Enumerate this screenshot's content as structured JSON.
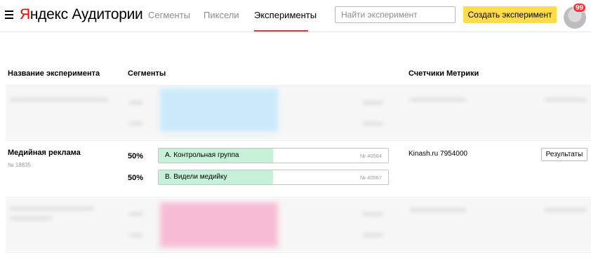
{
  "header": {
    "logo_brand": "Яндекс",
    "logo_product": "Аудитории",
    "nav": [
      {
        "label": "Сегменты",
        "active": false
      },
      {
        "label": "Пиксели",
        "active": false
      },
      {
        "label": "Эксперименты",
        "active": true
      }
    ],
    "search_placeholder": "Найти эксперимент",
    "create_button": "Создать эксперимент",
    "notifications_count": "99"
  },
  "table": {
    "columns": [
      "Название эксперимента",
      "Сегменты",
      "Счетчики Метрики"
    ],
    "experiment": {
      "name": "Медийная реклама",
      "id": "№ 18835",
      "segments": [
        {
          "percent": "50%",
          "label": "А. Контрольная группа",
          "number": "№ 40564"
        },
        {
          "percent": "50%",
          "label": "В. Видели медийку",
          "number": "№ 40567"
        }
      ],
      "counter": "Kinash.ru  7954000",
      "results_button": "Результаты"
    }
  },
  "colors": {
    "accent_red": "#ff3333",
    "create_button_bg": "#ffdb4d",
    "segment_fill": "#c7f0d9",
    "blur_segment_blue": "#c9e9fb",
    "blur_segment_pink": "#f6bcd6"
  }
}
